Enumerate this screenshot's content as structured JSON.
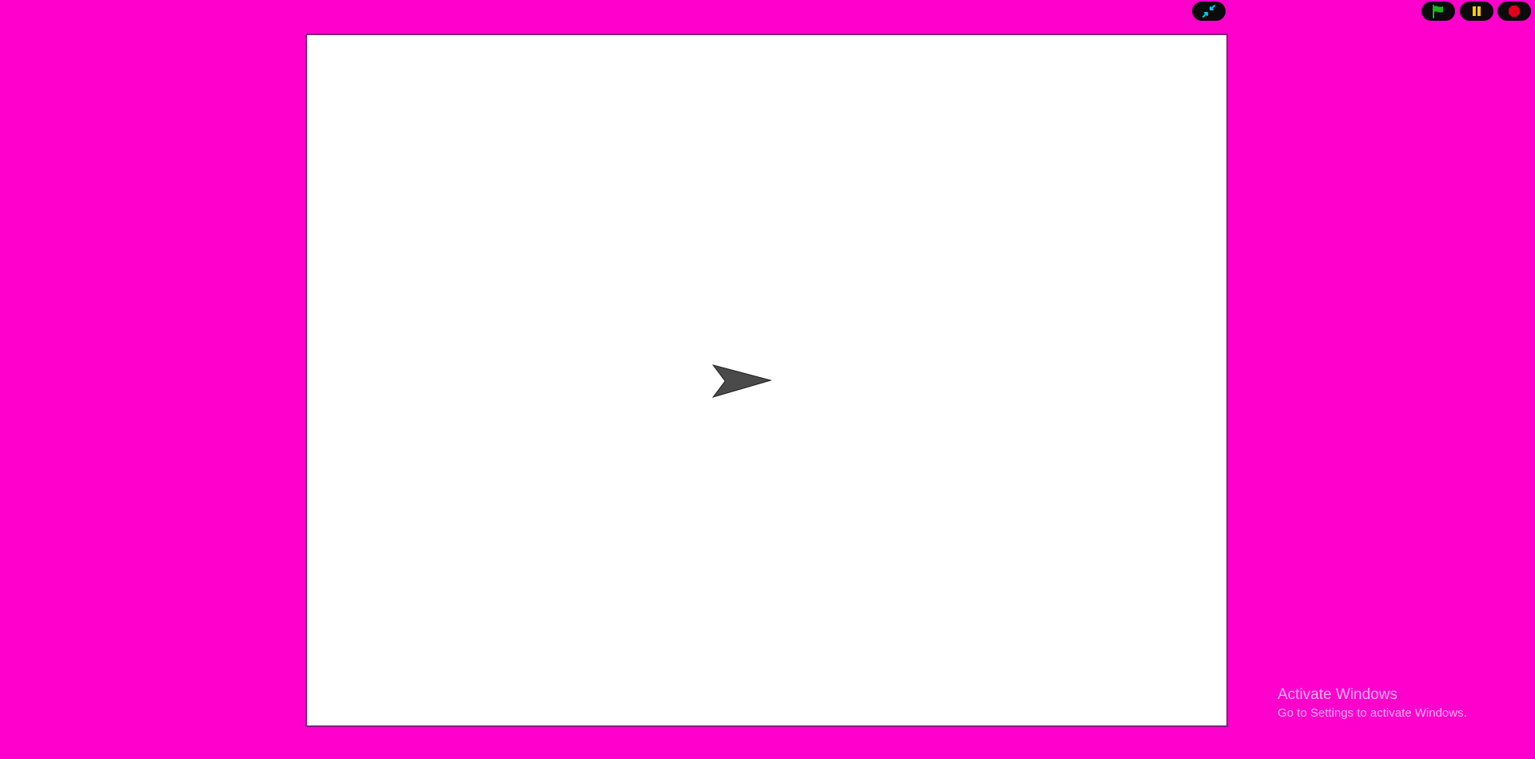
{
  "toolbar": {
    "fullscreen_icon": "shrink-arrows-icon",
    "flag_icon": "green-flag-icon",
    "pause_icon": "pause-icon",
    "stop_icon": "stop-icon"
  },
  "colors": {
    "background": "#ff00cc",
    "stage": "#ffffff",
    "stage_border": "#8a1e7a",
    "button_bg": "#0b0b0b",
    "shrink_icon": "#00c8ff",
    "flag": "#1fb31f",
    "pause": "#ffcc00",
    "stop": "#e0001b",
    "sprite": "#4a4a4a"
  },
  "stage": {
    "sprite_icon": "arrow-sprite"
  },
  "watermark": {
    "title": "Activate Windows",
    "subtitle": "Go to Settings to activate Windows."
  }
}
